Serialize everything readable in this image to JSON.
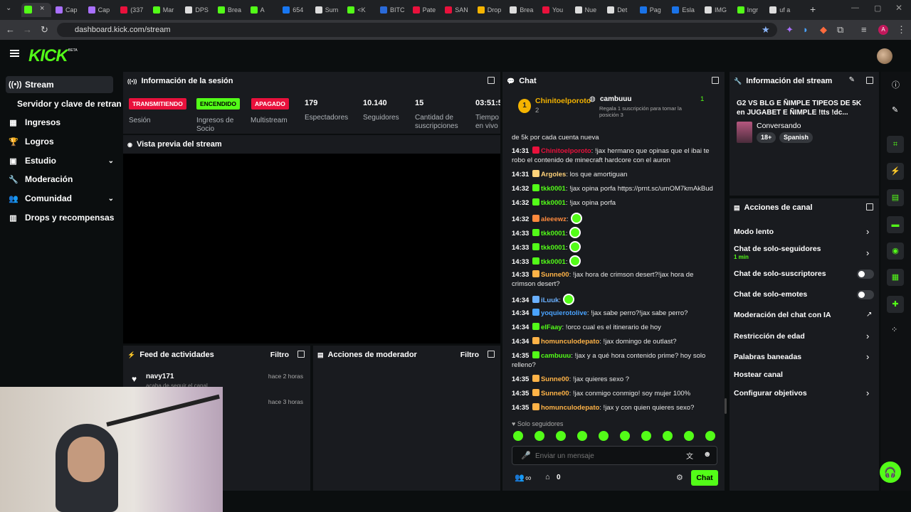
{
  "browser": {
    "tabs": [
      "Cap",
      "Cap",
      "(337",
      "Mar",
      "DPS",
      "Brea",
      "A",
      "654",
      "Sum",
      "<K",
      "BITC",
      "Pate",
      "SAN",
      "Drop",
      "Brea",
      "You",
      "Nue",
      "Det",
      "Pag",
      "Esla",
      "IMG",
      "Ingr",
      "uf a"
    ],
    "url": "dashboard.kick.com/stream"
  },
  "header": {
    "logo": "KICK",
    "beta": "BETA"
  },
  "sidebar": {
    "items": [
      {
        "label": "Stream"
      },
      {
        "label": "Servidor y clave de retransm"
      },
      {
        "label": "Ingresos"
      },
      {
        "label": "Logros"
      },
      {
        "label": "Estudio"
      },
      {
        "label": "Moderación"
      },
      {
        "label": "Comunidad"
      },
      {
        "label": "Drops y recompensas"
      }
    ]
  },
  "session": {
    "title": "Información de la sesión",
    "badges": [
      {
        "label": "TRANSMITIENDO",
        "caption": "Sesión",
        "color": "#e9113c"
      },
      {
        "label": "ENCENDIDO",
        "caption": "Ingresos de Socio",
        "color": "#53fc18"
      },
      {
        "label": "APAGADO",
        "caption": "Multistream",
        "color": "#e9113c"
      }
    ],
    "stats": [
      {
        "value": "179",
        "label": "Espectadores"
      },
      {
        "value": "10.140",
        "label": "Seguidores"
      },
      {
        "value": "15",
        "label": "Cantidad de suscripciones"
      },
      {
        "value": "03:51:5",
        "label": "Tiempo en vivo"
      }
    ]
  },
  "preview": {
    "title": "Vista previa del stream"
  },
  "activity": {
    "title": "Feed de actividades",
    "filter": "Filtro",
    "items": [
      {
        "user": "navy171",
        "action": "acaba de seguir el canal",
        "time": "hace 2 horas"
      },
      {
        "user": "",
        "action": "",
        "time": "hace 3 horas"
      }
    ]
  },
  "modactions": {
    "title": "Acciones de moderador",
    "filter": "Filtro"
  },
  "chat": {
    "title": "Chat",
    "pinned": {
      "rank": "1",
      "user1": "Chinitoelporoto",
      "count1": "2",
      "user2": "cambuuu",
      "count2": "1",
      "note": "Regala 1 suscripción para tomar la posición 3"
    },
    "partial_line": "de 5k por cada cuenta nueva",
    "messages": [
      {
        "t": "14:31",
        "u": "Chinitoelporoto",
        "m": ": !jax hermano que opinas que el ibai te robo el contenido de minecraft hardcore con el auron",
        "c": "#e9113c"
      },
      {
        "t": "14:31",
        "u": "Argoles",
        "m": ": los que amortiguan",
        "c": "#ffd27a"
      },
      {
        "t": "14:32",
        "u": "tkk0001",
        "m": ": !jax opina porfa https://prnt.sc/umOM7kmAkBud",
        "c": "#53fc18"
      },
      {
        "t": "14:32",
        "u": "tkk0001",
        "m": ": !jax opina porfa",
        "c": "#53fc18"
      },
      {
        "t": "14:32",
        "u": "aleeewz",
        "m": ":",
        "c": "#ff8a3d"
      },
      {
        "t": "14:33",
        "u": "tkk0001",
        "m": ":",
        "c": "#53fc18"
      },
      {
        "t": "14:33",
        "u": "tkk0001",
        "m": ":",
        "c": "#53fc18"
      },
      {
        "t": "14:33",
        "u": "tkk0001",
        "m": ":",
        "c": "#53fc18"
      },
      {
        "t": "14:33",
        "u": "Sunne00",
        "m": ": !jax hora de crimson desert?!jax hora de crimson desert?",
        "c": "#ffb347"
      },
      {
        "t": "14:34",
        "u": "iLuuk",
        "m": ":",
        "c": "#6ab0ff"
      },
      {
        "t": "14:34",
        "u": "yoquierotolive",
        "m": ": !jax sabe perro?!jax sabe perro?",
        "c": "#4aa3ff"
      },
      {
        "t": "14:34",
        "u": "elFaay",
        "m": ": !orco cual es el itinerario de hoy",
        "c": "#53fc18"
      },
      {
        "t": "14:34",
        "u": "homunculodepato",
        "m": ": !jax domingo de outlast?",
        "c": "#ffb347"
      },
      {
        "t": "14:35",
        "u": "cambuuu",
        "m": ": !jax y a qué hora contenido prime? hoy solo relleno?",
        "c": "#53fc18"
      },
      {
        "t": "14:35",
        "u": "Sunne00",
        "m": ": !jax quieres sexo ?",
        "c": "#ffb347"
      },
      {
        "t": "14:35",
        "u": "Sunne00",
        "m": ": !jax conmigo conmigo! soy mujer 100%",
        "c": "#ffb347"
      },
      {
        "t": "14:35",
        "u": "homunculodepato",
        "m": ": !jax y con quien quieres sexo?",
        "c": "#ffb347"
      }
    ],
    "followers_only": "Solo seguidores",
    "input_placeholder": "Enviar un mensaje",
    "zero": "0",
    "infinity": "∞",
    "send": "Chat"
  },
  "streaminfo": {
    "title": "Información del stream",
    "stream_title": "G2 VS BLG E ÑIMPLE TIPEOS DE 5K en JUGABET E ÑIMPLE !tts !dc...",
    "category": "Conversando",
    "tags": [
      "18+",
      "Spanish"
    ]
  },
  "channel": {
    "title": "Acciones de canal",
    "rows": [
      {
        "label": "Modo lento",
        "sub": ""
      },
      {
        "label": "Chat de solo-seguidores",
        "sub": "1 min"
      },
      {
        "label": "Chat de solo-suscriptores",
        "sub": ""
      },
      {
        "label": "Chat de solo-emotes",
        "sub": ""
      },
      {
        "label": "Moderación del chat con IA",
        "sub": ""
      },
      {
        "label": "Restricción de edad",
        "sub": ""
      },
      {
        "label": "Palabras baneadas",
        "sub": ""
      },
      {
        "label": "Hostear canal",
        "sub": ""
      },
      {
        "label": "Configurar objetivos",
        "sub": ""
      }
    ]
  },
  "colors": {
    "accent": "#53fc18",
    "panel": "#191b1f",
    "bg": "#0b0e0f",
    "live": "#e9113c"
  }
}
